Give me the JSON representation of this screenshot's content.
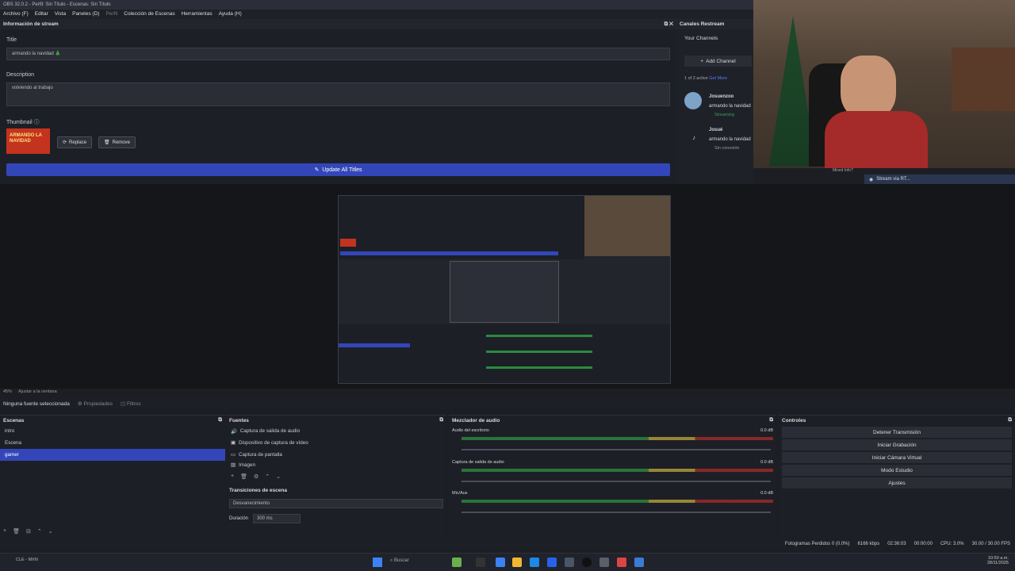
{
  "titlebar": {
    "text": "OBS 32.0.2 - Perfil: Sin Título - Escenas: Sin Título"
  },
  "menu": [
    "Archivo (F)",
    "Editar",
    "Vista",
    "Paneles (D)",
    "Perfil",
    "Colección de Escenas",
    "Herramientas",
    "Ayuda (H)"
  ],
  "stream_info": {
    "header": "Información de stream",
    "title_label": "Title",
    "title_value": "armando la navidad 🎄",
    "desc_label": "Description",
    "desc_value": "volviendo al trabajo",
    "thumb_label": "Thumbnail ⓘ",
    "thumb_text": "ARMANDO LA NAVIDAD",
    "replace": "Replace",
    "remove": "Remove",
    "update": "Update All Titles"
  },
  "restream": {
    "header": "Canales Restream",
    "your_channels": "Your Channels",
    "add_channel": "Add Channel",
    "active": "1 of 2 active",
    "get_more": "Get More",
    "channels": [
      {
        "name": "Josuenzoo",
        "title": "armando la navidad",
        "status": "Streaming"
      },
      {
        "name": "Josué",
        "title": "armando la navidad",
        "status": "Sin conexión"
      }
    ]
  },
  "webcam": {
    "stream_label": "Stream via RT...",
    "mic_label": "Mixed Info?"
  },
  "srcbar": {
    "none": "Ninguna fuente seleccionada",
    "props": "Propiedades",
    "filters": "Filtros",
    "zoom": "45%",
    "fit": "Ajustar a la ventana"
  },
  "scenes": {
    "header": "Escenas",
    "items": [
      "intro",
      "Escena",
      "gamer"
    ]
  },
  "sources": {
    "header": "Fuentes",
    "items": [
      "Captura de salida de audio",
      "Dispositivo de captura de vídeo",
      "Captura de pantalla",
      "Imagen"
    ]
  },
  "transitions": {
    "header": "Transiciones de escena",
    "type": "Desvanecimiento",
    "dur_label": "Duración",
    "dur_value": "300 ms"
  },
  "mixer": {
    "header": "Mezclador de audio",
    "channels": [
      {
        "name": "Audio del escritorio",
        "db": "0.0 dB"
      },
      {
        "name": "Captura de salida de audio",
        "db": "0.0 dB"
      },
      {
        "name": "Mic/Aux",
        "db": "0.0 dB"
      }
    ]
  },
  "controls": {
    "header": "Controles",
    "buttons": [
      "Detener Transmisión",
      "Iniciar Grabación",
      "Iniciar Cámara Virtual",
      "Modo Estudio",
      "Ajustes"
    ]
  },
  "status": {
    "dropped": "Fotogramas Perdidos 0 (0.0%)",
    "kbps": "6166 kbps",
    "live": "02:36:03",
    "rec": "00:00:00",
    "cpu": "CPU: 3.0%",
    "fps": "30.00 / 30.00 FPS"
  },
  "taskbar": {
    "search": "Buscar",
    "weather": "CLE - MXN",
    "time": "10:50 a.m.",
    "date": "28/11/2025"
  }
}
